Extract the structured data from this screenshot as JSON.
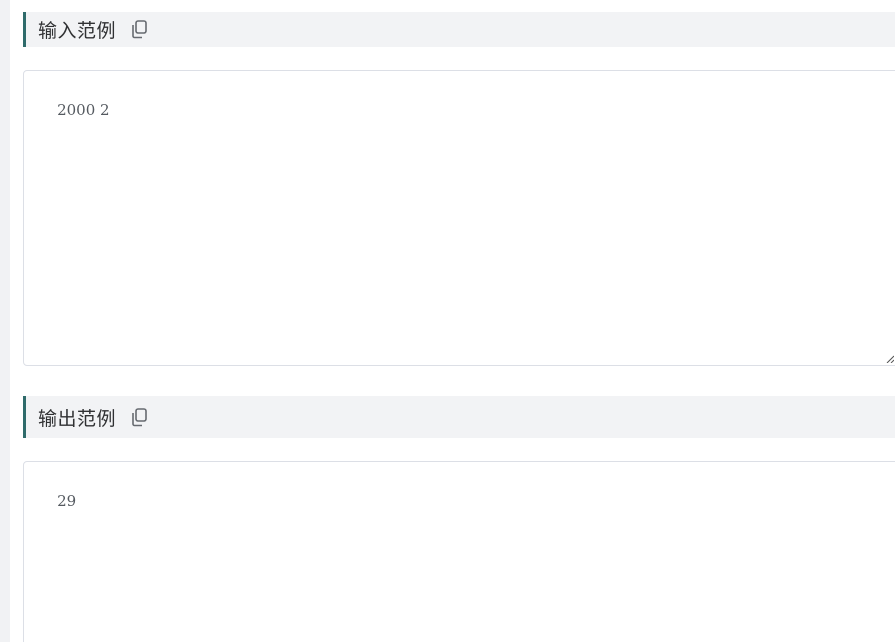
{
  "input_section": {
    "title": "输入范例",
    "copy_icon": "copy-icon",
    "content": "2000 2"
  },
  "output_section": {
    "title": "输出范例",
    "copy_icon": "copy-icon",
    "content": "29"
  },
  "colors": {
    "header_bg": "#f2f3f5",
    "accent_border": "#2f6b6b",
    "box_border": "#dcdfe6",
    "text": "#303133"
  }
}
